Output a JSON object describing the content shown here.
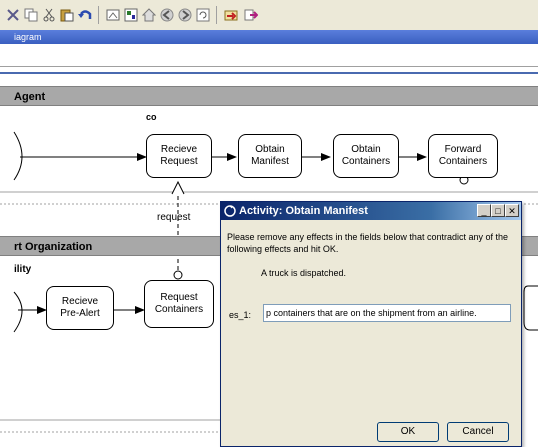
{
  "toolbar": {
    "icons": [
      "cut-x-icon",
      "copy-icon",
      "cut-icon",
      "paste-icon",
      "undo-icon",
      "frame-icon",
      "grid-icon",
      "home-icon",
      "back-icon",
      "forward-icon",
      "refresh-icon",
      "import-icon",
      "export-icon"
    ]
  },
  "diagram_bar": {
    "title": "iagram"
  },
  "lanes": [
    {
      "label": "Agent"
    },
    {
      "label": "rt Organization",
      "sub_label": "ility"
    }
  ],
  "tasks": {
    "recieve_request": "Recieve\nRequest",
    "obtain_manifest": "Obtain\nManifest",
    "obtain_containers": "Obtain\nContainers",
    "forward_containers": "Forward\nContainers",
    "recieve_prealert": "Recieve\nPre-Alert",
    "request_containers": "Request\nContainers"
  },
  "annotations": {
    "loop_marker": "co",
    "request_label": "request"
  },
  "dialog": {
    "title": "Activity: Obtain Manifest",
    "instructions": "Please remove any effects in the fields below that contradict any of the following effects and hit OK.",
    "effect": "A truck is dispatched.",
    "field_label": "es_1:",
    "field_value": "p containers that are on the shipment from an airline.",
    "ok_label": "OK",
    "cancel_label": "Cancel",
    "minimize": "_",
    "maximize": "□",
    "close": "✕"
  },
  "colors": {
    "accent": "#3a5fc0",
    "lane_header": "#a8a8a8",
    "dialog_title": "#0a246a"
  }
}
